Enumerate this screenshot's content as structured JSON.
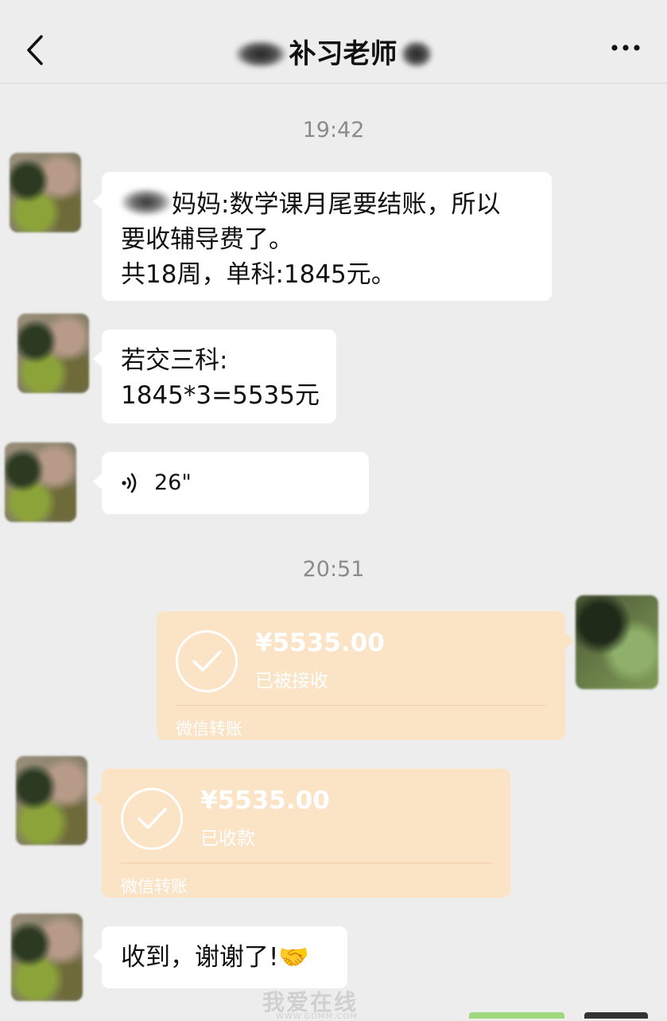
{
  "header": {
    "title": "补习老师",
    "back_icon": "chevron-left-icon",
    "more_icon": "more-dots-icon"
  },
  "timestamps": [
    "19:42",
    "20:51"
  ],
  "messages": {
    "m1": {
      "lines": [
        "妈妈:数学课月尾要结账，所以",
        "要收辅导费了。",
        "共18周，单科:1845元。"
      ]
    },
    "m2": {
      "lines": [
        "若交三科:",
        "1845*3=5535元"
      ]
    },
    "m3": {
      "voice_duration": "26\"",
      "icon": "voice-wave-icon"
    },
    "transfer_sent": {
      "amount": "¥5535.00",
      "status": "已被接收",
      "label": "微信转账"
    },
    "transfer_received": {
      "amount": "¥5535.00",
      "status": "已收款",
      "label": "微信转账"
    },
    "m4": {
      "text": "收到，谢谢了!🤝"
    }
  },
  "watermark": {
    "text": "我爱在线",
    "url": "WWW.GDMM.COM"
  },
  "colors": {
    "background": "#ededed",
    "bubble": "#ffffff",
    "transfer": "#fbe3c6"
  }
}
